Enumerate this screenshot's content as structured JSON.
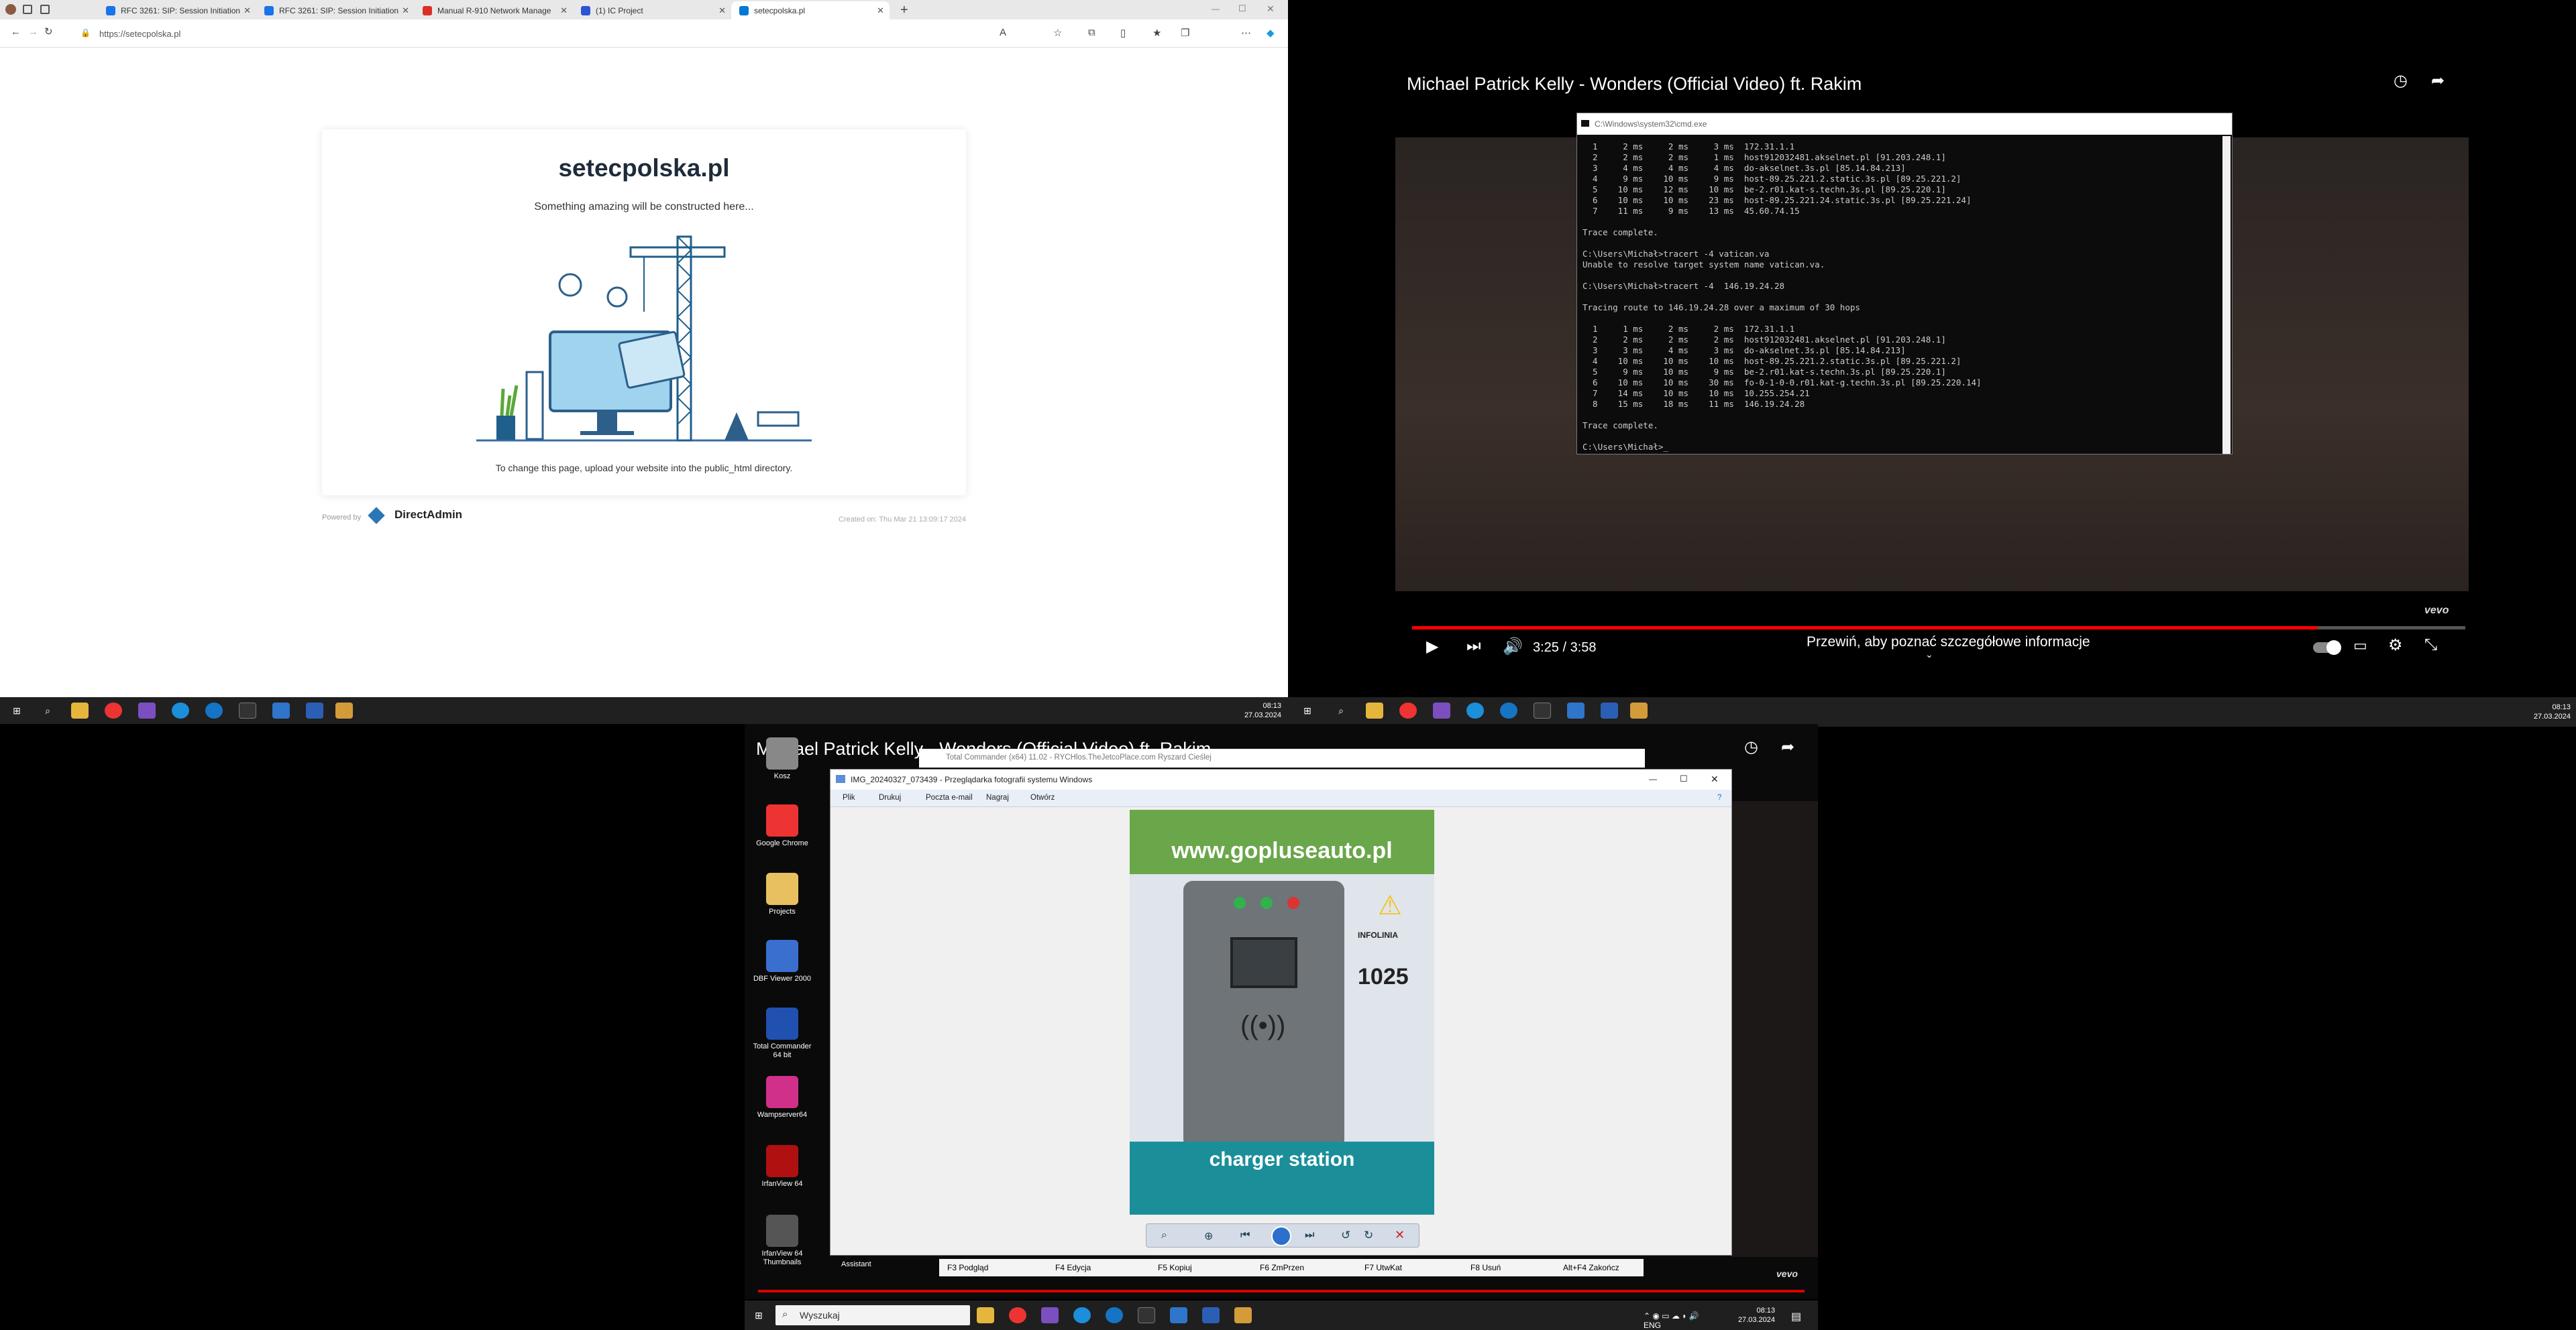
{
  "browser": {
    "tabs": [
      {
        "label": "RFC 3261: SIP: Session Initiation",
        "color": "#1a73e8"
      },
      {
        "label": "RFC 3261: SIP: Session Initiation",
        "color": "#1a73e8"
      },
      {
        "label": "Manual R-910 Network Manage",
        "color": "#d93025"
      },
      {
        "label": "(1) IC Project",
        "color": "#2c55d4"
      },
      {
        "label": "setecpolska.pl",
        "color": "#0078d4"
      }
    ],
    "url": "https://setecpolska.pl",
    "site_title": "setecpolska.pl",
    "site_subtitle": "Something amazing will be constructed here...",
    "site_hint": "To change this page, upload your website into the public_html directory.",
    "powered_by": "Powered by",
    "da_logo": "DirectAdmin",
    "created": "Created on: Thu Mar 21 13:09:17 2024"
  },
  "taskbar_top_left": {
    "time": "08:13",
    "date": "27.03.2024"
  },
  "taskbar_top_right": {
    "time": "08:13",
    "date": "27.03.2024"
  },
  "video": {
    "title": "Michael Patrick Kelly - Wonders (Official Video) ft. Rakim",
    "time": "3:25 / 3:58",
    "progress": 0.86,
    "info": "Przewiń, aby poznać szczegółowe informacje",
    "brand": "vevo"
  },
  "cmd": {
    "title": "C:\\Windows\\system32\\cmd.exe",
    "text": "  1     2 ms     2 ms     3 ms  172.31.1.1\n  2     2 ms     2 ms     1 ms  host912032481.akselnet.pl [91.203.248.1]\n  3     4 ms     4 ms     4 ms  do-akselnet.3s.pl [85.14.84.213]\n  4     9 ms    10 ms     9 ms  host-89.25.221.2.static.3s.pl [89.25.221.2]\n  5    10 ms    12 ms    10 ms  be-2.r01.kat-s.techn.3s.pl [89.25.220.1]\n  6    10 ms    10 ms    23 ms  host-89.25.221.24.static.3s.pl [89.25.221.24]\n  7    11 ms     9 ms    13 ms  45.60.74.15\n\nTrace complete.\n\nC:\\Users\\Michał>tracert -4 vatican.va\nUnable to resolve target system name vatican.va.\n\nC:\\Users\\Michał>tracert -4  146.19.24.28\n\nTracing route to 146.19.24.28 over a maximum of 30 hops\n\n  1     1 ms     2 ms     2 ms  172.31.1.1\n  2     2 ms     2 ms     2 ms  host912032481.akselnet.pl [91.203.248.1]\n  3     3 ms     4 ms     3 ms  do-akselnet.3s.pl [85.14.84.213]\n  4    10 ms    10 ms    10 ms  host-89.25.221.2.static.3s.pl [89.25.221.2]\n  5     9 ms    10 ms     9 ms  be-2.r01.kat-s.techn.3s.pl [89.25.220.1]\n  6    10 ms    10 ms    30 ms  fo-0-1-0-0.r01.kat-g.techn.3s.pl [89.25.220.14]\n  7    14 ms    10 ms    10 ms  10.255.254.21\n  8    15 ms    18 ms    11 ms  146.19.24.28\n\nTrace complete.\n\nC:\\Users\\Michał>_"
  },
  "desktop": {
    "video_title": "Michael Patrick Kelly - Wonders (Official Video) ft. Rakim",
    "icons": [
      {
        "label": "Kosz",
        "color": "#888"
      },
      {
        "label": "Google Chrome",
        "color": "#e33"
      },
      {
        "label": "Projects",
        "color": "#e8c060"
      },
      {
        "label": "DBF Viewer 2000",
        "color": "#3a6fd0"
      },
      {
        "label": "Total Commander 64 bit",
        "color": "#2050b0"
      },
      {
        "label": "Wampserver64",
        "color": "#d0308a"
      },
      {
        "label": "IrfanView 64",
        "color": "#b01010"
      },
      {
        "label": "IrfanView 64 Thumbnails",
        "color": "#555"
      }
    ],
    "assistant_label": "Assistant",
    "photo_viewer": {
      "title": "IMG_20240327_073439 - Przeglądarka fotografii systemu Windows",
      "menu": [
        "Plik",
        "Drukuj",
        "Poczta e-mail",
        "Nagraj",
        "Otwórz"
      ],
      "photo_text": {
        "site": "www.gopluseauto.pl",
        "station_label": "charger station",
        "number": "1025",
        "infolinia": "INFOLINIA"
      }
    },
    "total_commander_title": "Total Commander (x64) 11.02 - RYCHlos.TheJetcoPlace.com Ryszard Cieślej",
    "fkeys": [
      "F3 Podgląd",
      "F4 Edycja",
      "F5 Kopiuj",
      "F6 ZmPrzen",
      "F7 UtwKat",
      "F8 Usuń",
      "Alt+F4 Zakończ"
    ],
    "search_placeholder": "Wyszukaj",
    "clock": {
      "time": "08:13",
      "date": "27.03.2024"
    },
    "vevo": "vevo"
  }
}
